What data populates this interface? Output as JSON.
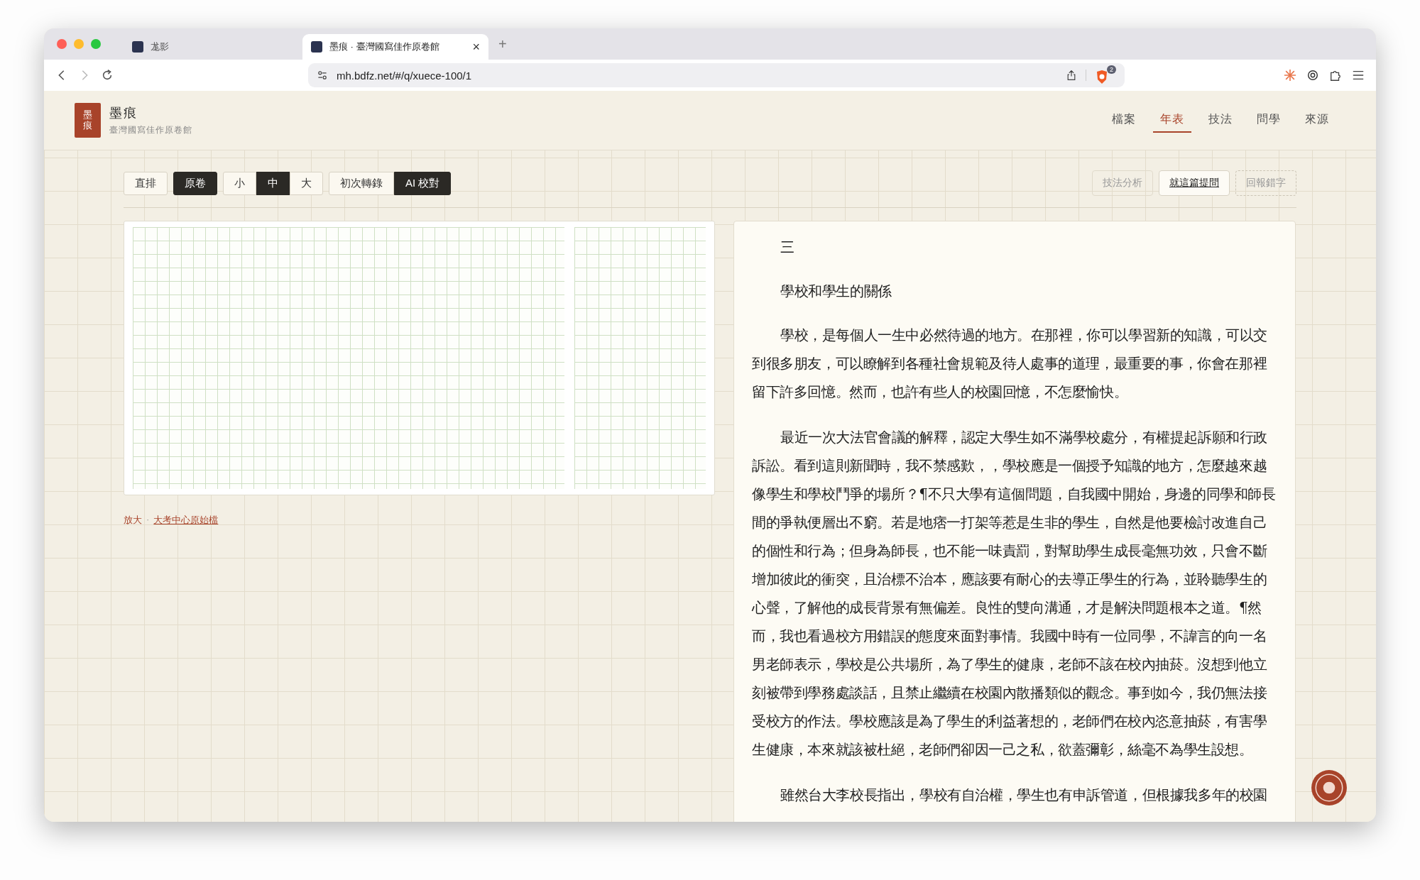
{
  "browser": {
    "tabs": [
      {
        "title": "尨影",
        "selected": false
      },
      {
        "title": "墨痕 · 臺灣國寫佳作原卷館",
        "selected": true
      }
    ],
    "close": "×",
    "new_tab": "+",
    "address": "mh.bdfz.net/#/q/xuece-100/1",
    "shield_badge": "2"
  },
  "site": {
    "logo_mark": "墨痕",
    "title": "墨痕",
    "subtitle": "臺灣國寫佳作原卷館"
  },
  "nav": [
    {
      "label": "檔案",
      "selected": false
    },
    {
      "label": "年表",
      "selected": true
    },
    {
      "label": "技法",
      "selected": false
    },
    {
      "label": "問學",
      "selected": false
    },
    {
      "label": "來源",
      "selected": false
    }
  ],
  "toolbar": [
    {
      "buttons": [
        {
          "label": "直排",
          "selected": false
        }
      ]
    },
    {
      "buttons": [
        {
          "label": "原卷",
          "selected": true
        }
      ]
    },
    {
      "buttons": [
        {
          "label": "小",
          "selected": false
        },
        {
          "label": "中",
          "selected": true
        },
        {
          "label": "大",
          "selected": false
        }
      ]
    },
    {
      "buttons": [
        {
          "label": "初次轉錄",
          "selected": false
        },
        {
          "label": "AI 校對",
          "selected": true
        }
      ]
    }
  ],
  "actions": [
    {
      "label": "技法分析",
      "kind": "muted"
    },
    {
      "label": "就這篇提問",
      "kind": "primary"
    },
    {
      "label": "回報錯字",
      "kind": "dashed"
    }
  ],
  "scan_caption": {
    "zoom": "放大",
    "separator": "·",
    "source": "大考中心原始檔"
  },
  "essay": {
    "number": "三",
    "title": "學校和學生的關係",
    "paragraphs": [
      "學校，是每個人一生中必然待過的地方。在那裡，你可以學習新的知識，可以交到很多朋友，可以瞭解到各種社會規範及待人處事的道理，最重要的事，你會在那裡留下許多回憶。然而，也許有些人的校園回憶，不怎麼愉快。",
      "最近一次大法官會議的解釋，認定大學生如不滿學校處分，有權提起訴願和行政訴訟。看到這則新聞時，我不禁感歎，，學校應是一個授予知識的地方，怎麼越來越像學生和學校鬥爭的場所？¶不只大學有這個問題，自我國中開始，身邊的同學和師長間的爭執便層出不窮。若是地痞一打架等惹是生非的學生，自然是他要檢討改進自己的個性和行為；但身為師長，也不能一味責罰，對幫助學生成長毫無功效，只會不斷增加彼此的衝突，且治標不治本，應該要有耐心的去導正學生的行為，並聆聽學生的心聲，了解他的成長背景有無偏差。良性的雙向溝通，才是解決問題根本之道。¶然而，我也看過校方用錯誤的態度來面對事情。我國中時有一位同學，不諱言的向一名男老師表示，學校是公共場所，為了學生的健康，老師不該在校內抽菸。沒想到他立刻被帶到學務處談話，且禁止繼續在校園內散播類似的觀念。事到如今，我仍無法接受校方的作法。學校應該是為了學生的利益著想的，老師們在校內恣意抽菸，有害學生健康，本來就該被杜絕，老師們卻因一己之私，欲蓋彌彰，絲毫不為學生設想。",
      "雖然台大李校長指出，學校有自治權，學生也有申訴管道，但根據我多年的校園"
    ]
  }
}
